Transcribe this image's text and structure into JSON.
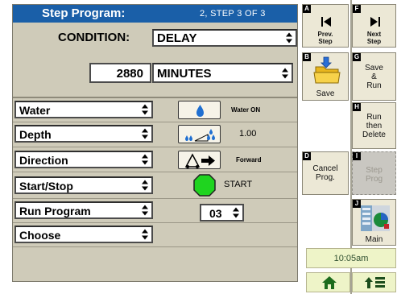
{
  "header": {
    "title": "Step Program:",
    "step": "2, STEP  3  OF  3"
  },
  "condition": {
    "label": "CONDITION:",
    "value": "DELAY",
    "amount": "2880",
    "unit": "MINUTES"
  },
  "rows": [
    {
      "label": "Water",
      "icon": "water-drop-icon",
      "value": "Water ON"
    },
    {
      "label": "Depth",
      "icon": "depth-drops-icon",
      "value": "1.00"
    },
    {
      "label": "Direction",
      "icon": "direction-arrow-icon",
      "value": "Forward"
    },
    {
      "label": "Start/Stop",
      "icon": "start-octagon-icon",
      "value": "START"
    },
    {
      "label": "Run Program",
      "value": "03"
    },
    {
      "label": "Choose"
    }
  ],
  "buttons": {
    "prev_step": {
      "key": "A",
      "label": "Prev.\nStep",
      "icon": "skip-back-icon"
    },
    "next_step": {
      "key": "F",
      "label": "Next\nStep",
      "icon": "skip-forward-icon"
    },
    "save": {
      "key": "B",
      "label": "Save",
      "icon": "folder-save-icon"
    },
    "save_run": {
      "key": "G",
      "label": "Save\n&\nRun"
    },
    "run_delete": {
      "key": "H",
      "label": "Run\nthen\nDelete"
    },
    "cancel_prog": {
      "key": "D",
      "label": "Cancel\nProg."
    },
    "step_prog": {
      "key": "I",
      "label": "Step\nProg",
      "disabled": true
    },
    "main": {
      "key": "J",
      "label": "Main",
      "icon": "main-screen-icon"
    }
  },
  "time": "10:05am",
  "nav": {
    "home_icon": "home-icon",
    "menu_icon": "up-list-icon"
  },
  "colors": {
    "title_bar": "#1a5fa8",
    "panel": "#cfcbb9",
    "button": "#ece8d6",
    "status": "#eef4c8"
  }
}
